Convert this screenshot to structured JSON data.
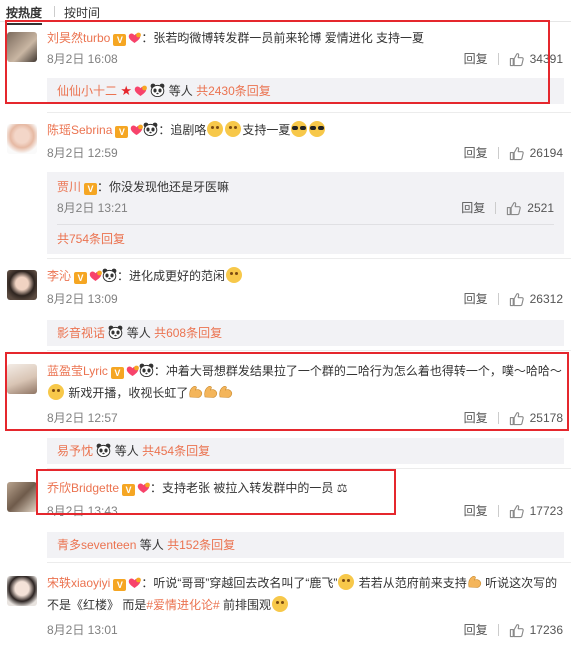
{
  "sort": {
    "by_hot": "按热度",
    "by_time": "按时间"
  },
  "comments": [
    {
      "user": "刘昊然turbo",
      "text": "：张若昀微博转发群一员前来轮博 爱情进化 支持一夏",
      "time": "8月2日 16:08",
      "reply_label": "回复",
      "likes": "34391",
      "summary": {
        "users": "仙仙小十二",
        "middle": "等人",
        "count": "共2430条回复"
      }
    },
    {
      "user": "陈瑶Sebrina",
      "text_a": "：追剧咯",
      "text_b": "支持一夏",
      "time": "8月2日 12:59",
      "reply_label": "回复",
      "likes": "26194",
      "sub_reply": {
        "user": "贾川",
        "text": "：你没发现他还是牙医嘛",
        "time": "8月2日 13:21",
        "reply_label": "回复",
        "likes": "2521"
      },
      "summary": {
        "count": "共754条回复"
      }
    },
    {
      "user": "李沁",
      "text": "：进化成更好的范闲",
      "time": "8月2日 13:09",
      "reply_label": "回复",
      "likes": "26312",
      "summary": {
        "users": "影音视话",
        "middle": "等人",
        "count": "共608条回复"
      }
    },
    {
      "user": "蓝盈莹Lyric",
      "text_a": "：冲着大哥想群发结果拉了一个群的二哈行为怎么着也得转一个，噗～哈哈",
      "text_b": "～",
      "text_c": "新戏开播，收视长虹了",
      "time": "8月2日 12:57",
      "reply_label": "回复",
      "likes": "25178",
      "summary": {
        "users": "易予忱",
        "middle": "等人",
        "count": "共454条回复"
      }
    },
    {
      "user": "乔欣Bridgette",
      "text": "：支持老张 被拉入转发群中的一员",
      "time": "8月2日 13:43",
      "reply_label": "回复",
      "likes": "17723",
      "summary": {
        "users": "青多seventeen",
        "middle": "等人",
        "count": "共152条回复"
      }
    },
    {
      "user": "宋轶xiaoyiyi",
      "text_a": "：听说“哥哥”穿越回去改名叫了“鹿飞”",
      "text_b": "若若从范府前来支持",
      "text_c": "听说这次写的不是《红楼》 而是",
      "tag": "#爱情进化论#",
      "text_d": "前排围观",
      "time": "8月2日 13:01",
      "reply_label": "回复",
      "likes": "17236"
    }
  ],
  "colors": {
    "name": "#eb7350",
    "highlight_box": "#e5272d",
    "sub_bg": "#f2f2f5"
  }
}
